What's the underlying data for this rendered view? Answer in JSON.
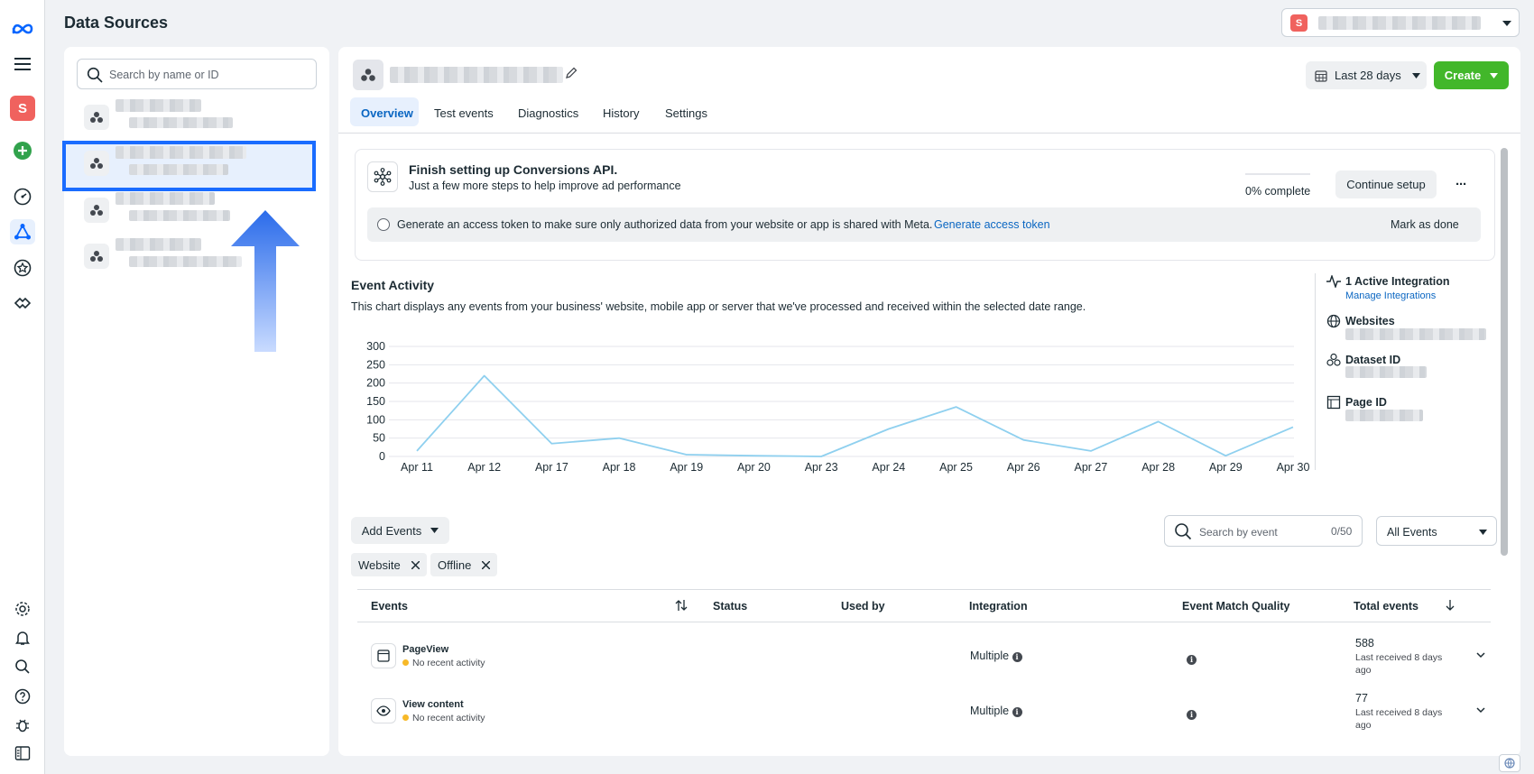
{
  "page": {
    "title": "Data Sources"
  },
  "account": {
    "badge": "S"
  },
  "left_rail": {
    "avatar": "S"
  },
  "search": {
    "placeholder": "Search by name or ID"
  },
  "tabs": [
    "Overview",
    "Test events",
    "Diagnostics",
    "History",
    "Settings"
  ],
  "header": {
    "date_range": "Last 28 days",
    "create": "Create"
  },
  "setup": {
    "title": "Finish setting up Conversions API.",
    "subtitle": "Just a few more steps to help improve ad performance",
    "progress": "0% complete",
    "progress_value": 0,
    "continue": "Continue setup",
    "more": "···",
    "task": "Generate an access token to make sure only authorized data from your website or app is shared with Meta.",
    "task_link": "Generate access token",
    "mark_done": "Mark as done"
  },
  "activity": {
    "title": "Event Activity",
    "description": "This chart displays any events from your business' website, mobile app or server that we've processed and received within the selected date range."
  },
  "chart_data": {
    "type": "line",
    "categories": [
      "Apr 11",
      "Apr 12",
      "Apr 17",
      "Apr 18",
      "Apr 19",
      "Apr 20",
      "Apr 23",
      "Apr 24",
      "Apr 25",
      "Apr 26",
      "Apr 27",
      "Apr 28",
      "Apr 29",
      "Apr 30"
    ],
    "series": [
      {
        "values": [
          15,
          220,
          35,
          50,
          5,
          2,
          0,
          75,
          135,
          45,
          15,
          95,
          2,
          80
        ]
      }
    ],
    "yticks": [
      0,
      50,
      100,
      150,
      200,
      250,
      300
    ],
    "ylim": [
      0,
      300
    ],
    "color": "#8fd0ef",
    "grid": true
  },
  "side_info": {
    "integration": "1 Active Integration",
    "manage": "Manage Integrations",
    "websites": "Websites",
    "dataset": "Dataset ID",
    "page": "Page ID"
  },
  "events_toolbar": {
    "add_events": "Add Events",
    "search_placeholder": "Search by event",
    "counter": "0/50",
    "filter": "All Events",
    "chips": [
      "Website",
      "Offline"
    ]
  },
  "table": {
    "headers": {
      "events": "Events",
      "status": "Status",
      "used_by": "Used by",
      "integration": "Integration",
      "emq": "Event Match Quality",
      "total": "Total events"
    },
    "rows": [
      {
        "name": "PageView",
        "status": "No recent activity",
        "integration": "Multiple",
        "total": "588",
        "received": "Last received 8 days ago"
      },
      {
        "name": "View content",
        "status": "No recent activity",
        "integration": "Multiple",
        "total": "77",
        "received": "Last received 8 days ago"
      }
    ]
  }
}
